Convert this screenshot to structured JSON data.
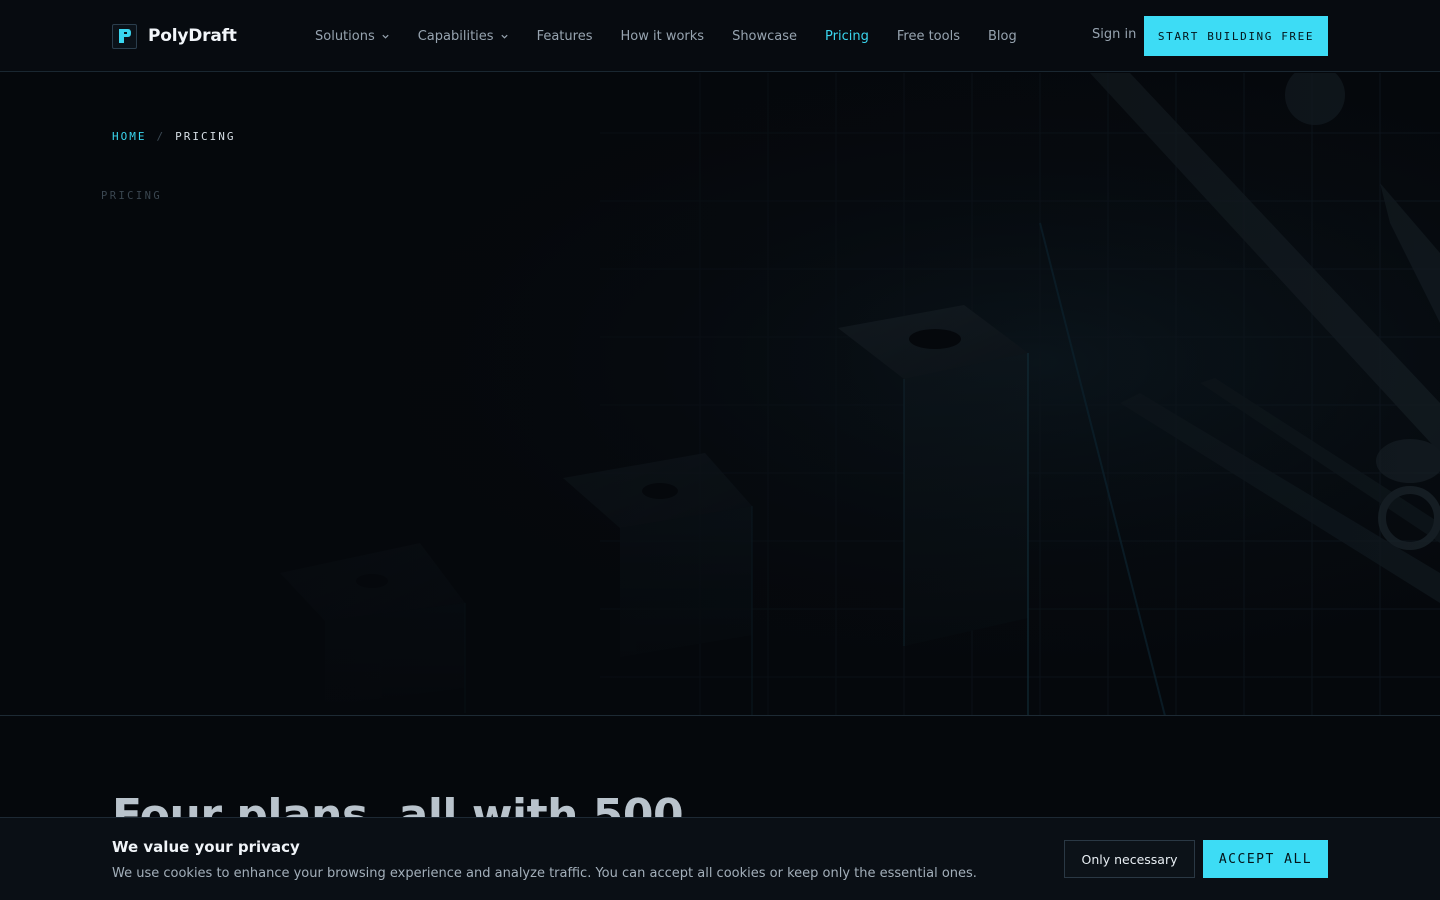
{
  "brand": {
    "name": "PolyDraft",
    "logo_letter": "P"
  },
  "nav": {
    "items": [
      {
        "label": "Solutions",
        "dropdown": true,
        "active": false
      },
      {
        "label": "Capabilities",
        "dropdown": true,
        "active": false
      },
      {
        "label": "Features",
        "dropdown": false,
        "active": false
      },
      {
        "label": "How it works",
        "dropdown": false,
        "active": false
      },
      {
        "label": "Showcase",
        "dropdown": false,
        "active": false
      },
      {
        "label": "Pricing",
        "dropdown": false,
        "active": true
      },
      {
        "label": "Free tools",
        "dropdown": false,
        "active": false
      },
      {
        "label": "Blog",
        "dropdown": false,
        "active": false
      }
    ],
    "signin_label": "Sign in",
    "cta_label": "START BUILDING FREE"
  },
  "hero": {
    "breadcrumb": {
      "home": "HOME",
      "separator": "/",
      "current": "PRICING"
    },
    "eyebrow": "PRICING"
  },
  "headline": "Four plans, all with 500",
  "cookie": {
    "title": "We value your privacy",
    "text": "We use cookies to enhance your browsing experience and analyze traffic. You can accept all cookies or keep only the essential ones.",
    "necessary_label": "Only necessary",
    "accept_label": "ACCEPT ALL"
  },
  "colors": {
    "accent": "#3ddcf5",
    "background": "#05080c",
    "muted_text": "#97a4b0"
  }
}
